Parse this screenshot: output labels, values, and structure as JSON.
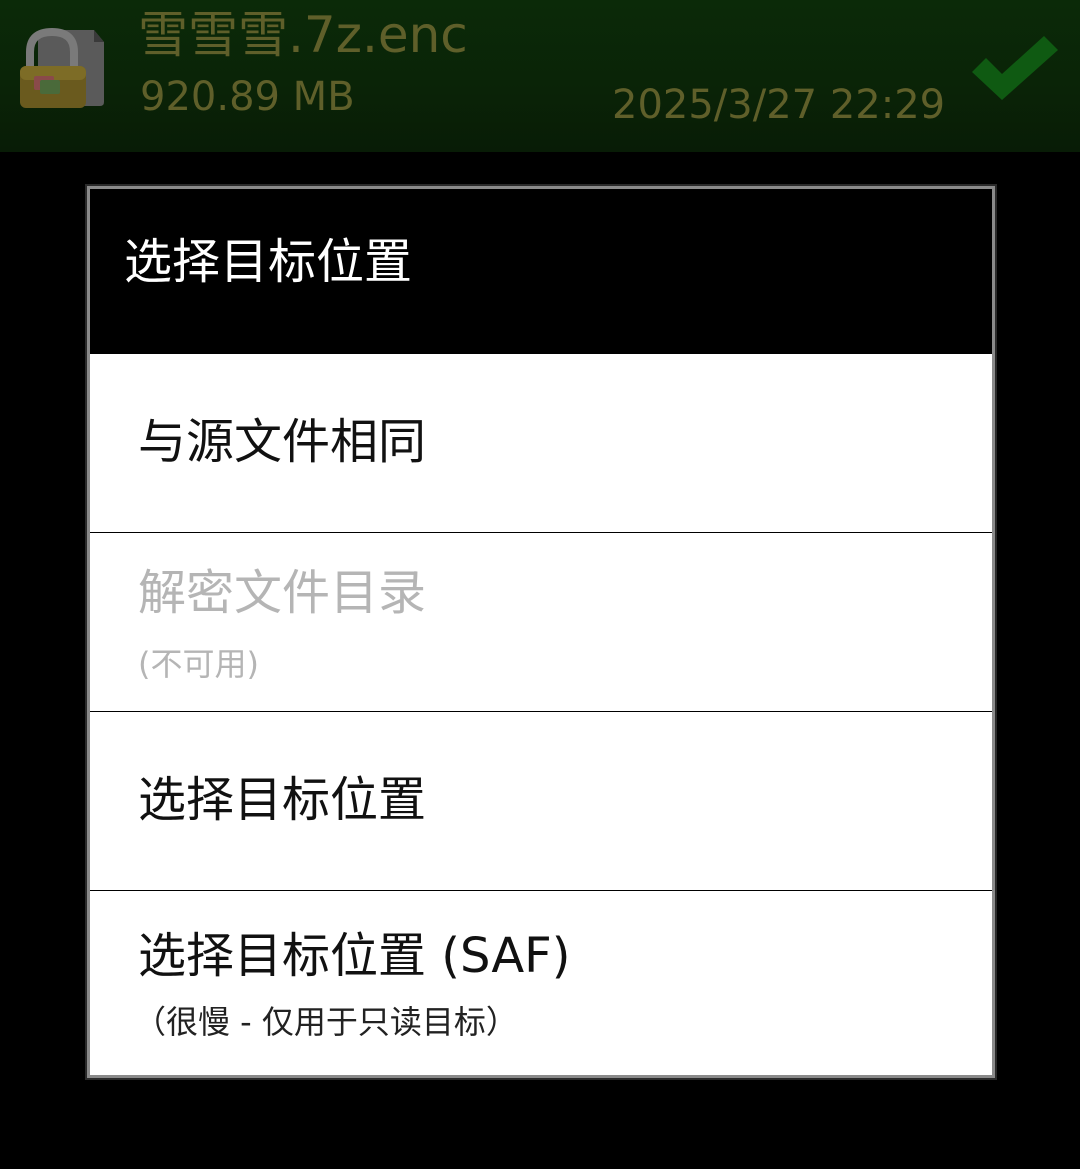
{
  "file": {
    "name": "雪雪雪.7z.enc",
    "size": "920.89 MB",
    "date": "2025/3/27 22:29",
    "icon": "locked-file-icon",
    "status_icon": "checkmark-icon",
    "text_color": "#5f5f2a",
    "check_color": "#0f5a12"
  },
  "dialog": {
    "title": "选择目标位置",
    "options": [
      {
        "label": "与源文件相同",
        "sublabel": "",
        "enabled": true
      },
      {
        "label": "解密文件目录",
        "sublabel": "(不可用)",
        "enabled": false
      },
      {
        "label": "选择目标位置",
        "sublabel": "",
        "enabled": true
      },
      {
        "label": "选择目标位置 (SAF)",
        "sublabel": "（很慢 - 仅用于只读目标）",
        "enabled": true
      }
    ]
  }
}
